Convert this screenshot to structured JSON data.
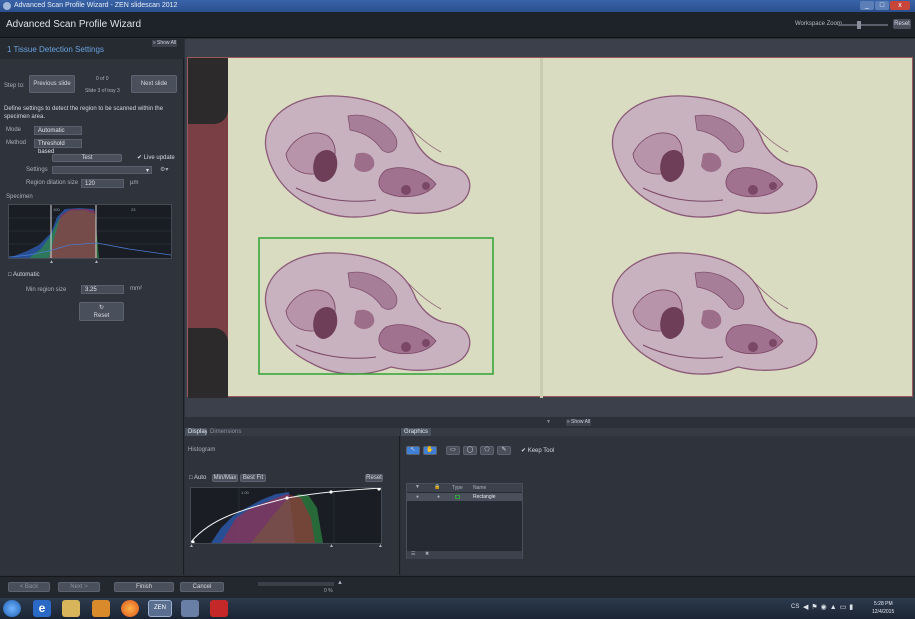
{
  "window": {
    "title": "Advanced Scan Profile Wizard - ZEN slidescan 2012",
    "min": "_",
    "max": "□",
    "close": "x"
  },
  "header": {
    "app_name": "Advanced Scan Profile Wizard",
    "workspace_zoom": "Workspace Zoom",
    "reset": "Reset"
  },
  "left": {
    "section_title": "1  Tissue Detection Settings",
    "show_all": "» Show All",
    "step_to": "Step to:",
    "prev_slide": "Previous slide",
    "next_slide": "Next slide",
    "counter_1": "0 of 0",
    "counter_2": "Slide 3 of tray 3",
    "description": "Define settings to detect the region to be scanned within the specimen area.",
    "mode_label": "Mode",
    "mode_value": "Automatic",
    "method_label": "Method",
    "method_value": "Threshold based",
    "test_button": "Test",
    "live_update": "Live update",
    "settings_label": "Settings",
    "dilation_label": "Region dilation size",
    "dilation_value": "120",
    "dilation_unit": "µm",
    "specimen_label": "Specimen",
    "automatic_label": "Automatic",
    "min_region_label": "Min region size",
    "min_region_value": "3.25",
    "min_region_unit": "mm²",
    "reset_button": "Reset",
    "hist_ticks": [
      "100",
      "23"
    ]
  },
  "viewer": {
    "show_all": "» Show All"
  },
  "display": {
    "tab_display": "Display",
    "tab_dimensions": "Dimensions",
    "histogram": "Histogram",
    "auto": "Auto",
    "minmax": "Min/Max",
    "bestfit": "Best Fit",
    "reset": "Reset",
    "gamma_tick": "1.00"
  },
  "graphics": {
    "tab": "Graphics",
    "keep_tool": "Keep Tool",
    "col_type": "Type",
    "col_name": "Name",
    "row_name": "Rectangle"
  },
  "footer": {
    "back": "< Back",
    "next": "Next >",
    "finish": "Finish",
    "cancel": "Cancel",
    "progress": "0 %",
    "progress_value": 0
  },
  "taskbar": {
    "lang": "CS",
    "time": "5:28 PM",
    "date": "12/4/2015",
    "zen_label": "ZEN"
  },
  "colors": {
    "accent": "#6aa4e0",
    "selection_green": "#2fa336",
    "tissue": "#8b5a78"
  }
}
